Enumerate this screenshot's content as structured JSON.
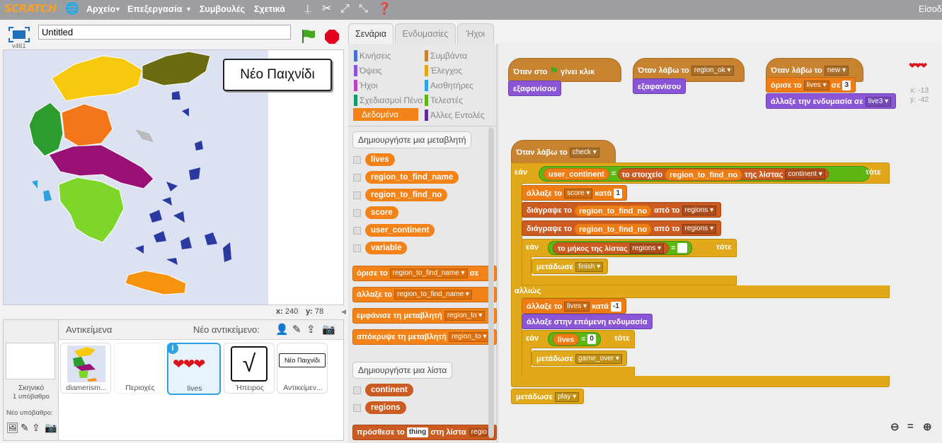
{
  "menubar": {
    "logo": "SCRATCH",
    "file": "Αρχείο",
    "edit": "Επεξεργασία",
    "tips": "Συμβουλές",
    "about": "Σχετικά",
    "signin": "Είσοδ"
  },
  "stage": {
    "title_value": "Untitled",
    "version": "v461",
    "new_game": "Νέο Παιχνίδι",
    "x_label": "x:",
    "x_val": "240",
    "y_label": "y:",
    "y_val": "78"
  },
  "sprites": {
    "header": "Αντικείμενα",
    "new_sprite": "Νέο αντικείμενο:",
    "stage_label": "Σκηνικό",
    "stage_bg": "1 υπόβαθρο",
    "new_bg": "Νέο υπόβαθρο:",
    "items": [
      {
        "name": "diamerism..."
      },
      {
        "name": "Περιοχές"
      },
      {
        "name": "lives"
      },
      {
        "name": "Ήπειρος"
      },
      {
        "name": "Αντικείμεν..."
      }
    ],
    "thumb_button": "Νέο Παιχνίδι"
  },
  "tabs": [
    "Σενάρια",
    "Ενδυμασίες",
    "Ήχοι"
  ],
  "categories": [
    {
      "label": "Κινήσεις",
      "color": "#4a6cd4"
    },
    {
      "label": "Συμβάντα",
      "color": "#c88330"
    },
    {
      "label": "Όψεις",
      "color": "#8a55d7"
    },
    {
      "label": "Έλεγχος",
      "color": "#e1a91a"
    },
    {
      "label": "Ήχοι",
      "color": "#bb42c3"
    },
    {
      "label": "Αισθητήρες",
      "color": "#2ca5e2"
    },
    {
      "label": "Σχεδιασμοί Πένα",
      "color": "#0e9a6c"
    },
    {
      "label": "Τελεστές",
      "color": "#5cb712"
    },
    {
      "label": "Δεδομένα",
      "color": "#ee7d16"
    },
    {
      "label": "Άλλες Εντολές",
      "color": "#632d99"
    }
  ],
  "palette": {
    "make_var": "Δημιουργήστε μια μεταβλητή",
    "vars": [
      "lives",
      "region_to_find_name",
      "region_to_find_no",
      "score",
      "user_continent",
      "variable"
    ],
    "set_label": "όρισε το",
    "set_var": "region_to_find_name",
    "set_to": "σε",
    "change_label": "άλλαξε το",
    "change_var": "region_to_find_name",
    "show_label": "εμφάνισε τη μεταβλητή",
    "show_var": "region_to",
    "hide_label": "απόκρυψε τη μεταβλητή",
    "hide_var": "region_to",
    "make_list": "Δημιουργήστε μια λίστα",
    "lists": [
      "continent",
      "regions"
    ],
    "add_label": "πρόσθεσε το",
    "add_val": "thing",
    "add_to": "στη λίστα",
    "add_list": "regio"
  },
  "scripts": {
    "s1": {
      "when": "Όταν στο",
      "clicked": "γίνει κλικ",
      "hide": "εξαφανίσου"
    },
    "s2": {
      "when": "Όταν λάβω το",
      "msg": "region_ok",
      "hide": "εξαφανίσου"
    },
    "s3": {
      "when": "Όταν λάβω το",
      "msg": "new",
      "set": "όρισε το",
      "var": "lives",
      "to": "σε",
      "val": "3",
      "switch": "άλλαξε την ενδυμασία σε",
      "costume": "live3"
    },
    "s4": {
      "when": "Όταν λάβω το",
      "msg": "check",
      "if": "εάν",
      "then": "τότε",
      "ucont": "user_continent",
      "eq": "=",
      "item": "το στοιχείο",
      "rtfn": "region_to_find_no",
      "of_list": "της λίστας",
      "continent": "continent",
      "change": "άλλαξε το",
      "score": "score",
      "by": "κατά",
      "one": "1",
      "delete": "διάγραψε το",
      "of": "από το",
      "regions": "regions",
      "len": "το μήκος της λίστας",
      "broadcast": "μετάδωσε",
      "finish": "finish",
      "else": "αλλιώς",
      "lives": "lives",
      "minus_one": "-1",
      "next": "άλλαξε στην επόμενη ενδυμασία",
      "zero": "0",
      "game_over": "game_over",
      "play": "play"
    },
    "corner_x": "x: -13",
    "corner_y": "y: -42"
  }
}
